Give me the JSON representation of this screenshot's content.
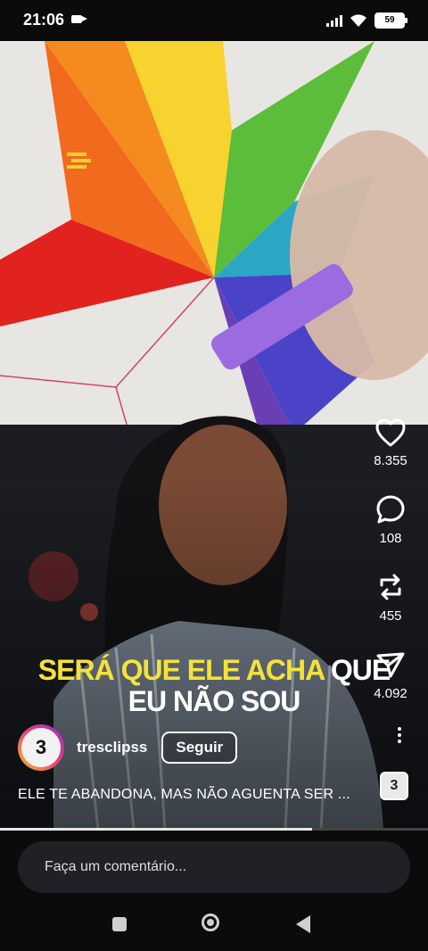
{
  "status": {
    "time": "21:06",
    "battery": "59"
  },
  "video": {
    "caption_yellow": "SERÁ QUE ELE ACHA",
    "caption_white": "QUE",
    "caption_line2": "EU NÃO SOU"
  },
  "actions": {
    "likes": "8.355",
    "comments": "108",
    "reposts": "455",
    "shares": "4.092"
  },
  "author": {
    "username": "tresclipss",
    "follow_label": "Seguir",
    "avatar_initial": "3"
  },
  "description": "ELE TE ABANDONA, MAS NÃO AGUENTA SER ...",
  "comment_placeholder": "Faça um comentário...",
  "progress": 0.73
}
